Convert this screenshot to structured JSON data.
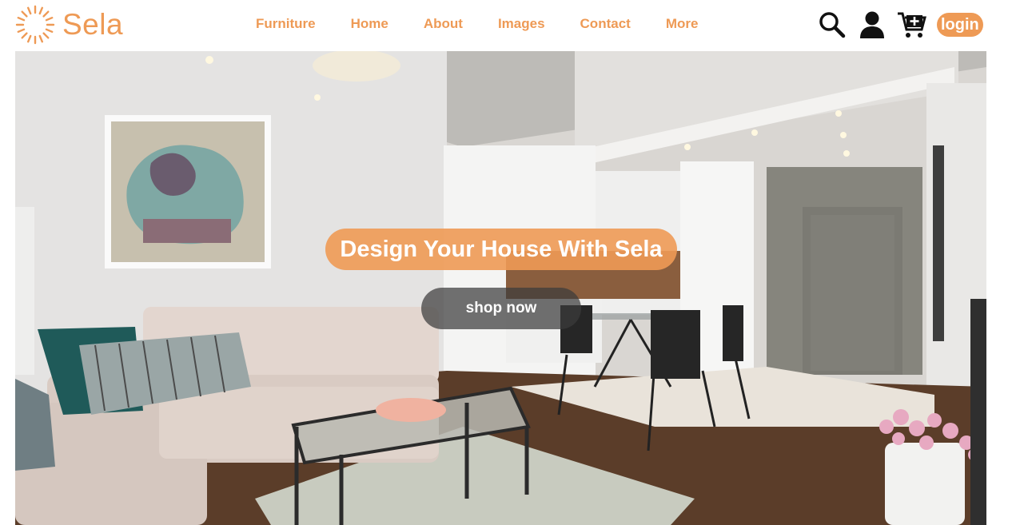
{
  "brand": {
    "name": "Sela",
    "logo_icon": "sun-icon",
    "accent_color": "#ee9a55"
  },
  "nav": {
    "links": [
      {
        "label": "Furniture"
      },
      {
        "label": "Home"
      },
      {
        "label": "About"
      },
      {
        "label": "Images"
      },
      {
        "label": "Contact"
      },
      {
        "label": "More"
      }
    ]
  },
  "header_actions": {
    "icons": [
      "search-icon",
      "user-icon",
      "cart-add-icon"
    ],
    "login_label": "login"
  },
  "hero": {
    "headline": "Design Your House With Sela",
    "cta_label": "shop now"
  }
}
